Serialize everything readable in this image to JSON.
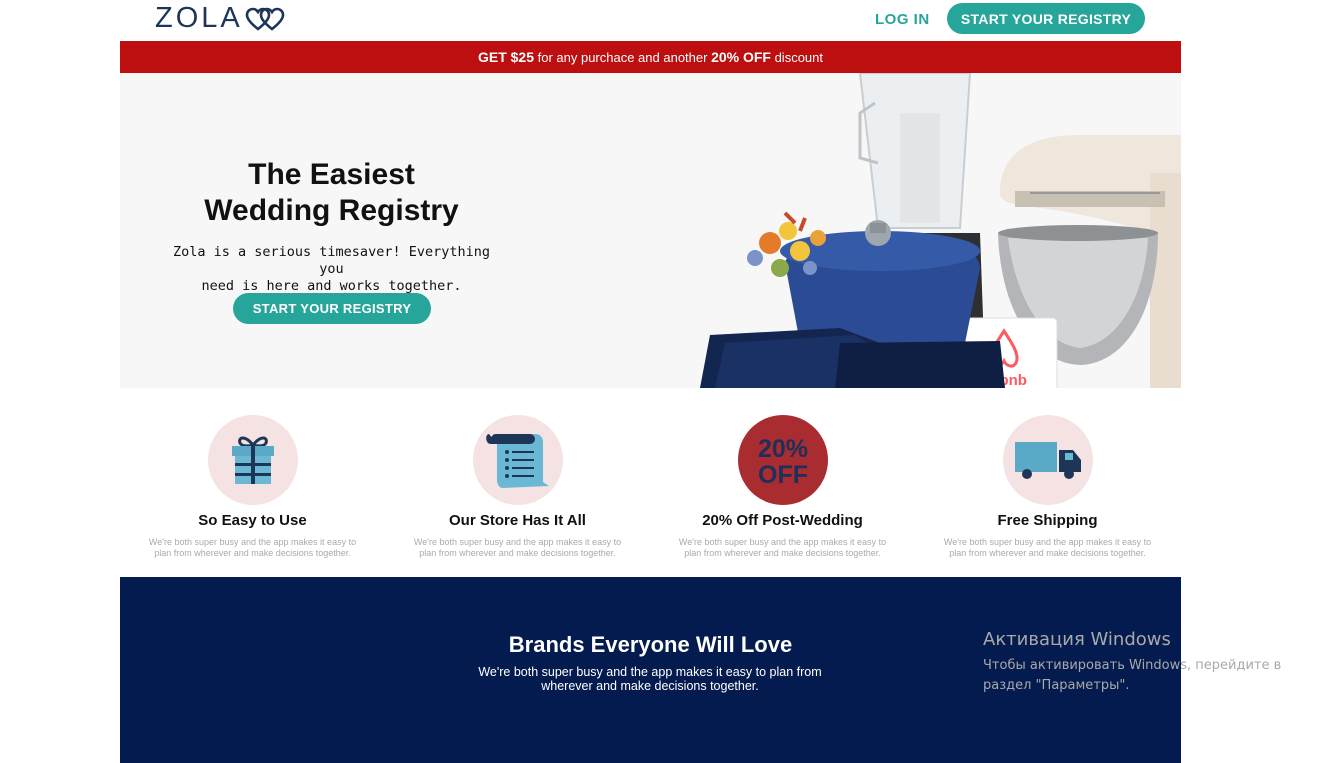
{
  "header": {
    "logo_text": "ZOLA",
    "login_label": "LOG IN",
    "cta_label": "START YOUR REGISTRY"
  },
  "promo": {
    "part1": "GET $25",
    "part2": " for any purchace and another ",
    "part3": "20% OFF",
    "part4": " discount"
  },
  "hero": {
    "title_line1": "The Easiest",
    "title_line2": "Wedding Registry",
    "subtitle_line1": "Zola is a serious timesaver! Everything you",
    "subtitle_line2": "need is here and works together.",
    "cta_label": "START YOUR REGISTRY",
    "airbnb_text": "airbnb"
  },
  "features": [
    {
      "title": "So Easy to Use",
      "desc": "We're both super busy and the app makes it easy to plan from wherever and make decisions together.",
      "icon": "gift-icon"
    },
    {
      "title": "Our Store Has It All",
      "desc": "We're both super busy and the app makes it easy to plan from wherever and make decisions together.",
      "icon": "scroll-list-icon"
    },
    {
      "title": "20% Off Post-Wedding",
      "desc": "We're both super busy and the app makes it easy to plan from wherever and make decisions together.",
      "icon": "discount-badge-icon",
      "badge_line1": "20%",
      "badge_line2": "OFF"
    },
    {
      "title": "Free Shipping",
      "desc": "We're both super busy and the app makes it easy to plan from wherever and make decisions together.",
      "icon": "truck-icon"
    }
  ],
  "brands": {
    "title": "Brands Everyone Will Love",
    "subtitle_line1": "We're both super busy and the app makes it easy to plan from",
    "subtitle_line2": "wherever and make decisions together."
  },
  "watermark": {
    "title": "Активация Windows",
    "line1": "Чтобы активировать Windows, перейдите в",
    "line2": "раздел \"Параметры\"."
  },
  "colors": {
    "teal": "#26a69a",
    "promo_red": "#bd0f10",
    "navy": "#031b4e",
    "logo_navy": "#1d3557",
    "feature_circle": "#f5e3e3",
    "badge_red": "#a92c30"
  }
}
